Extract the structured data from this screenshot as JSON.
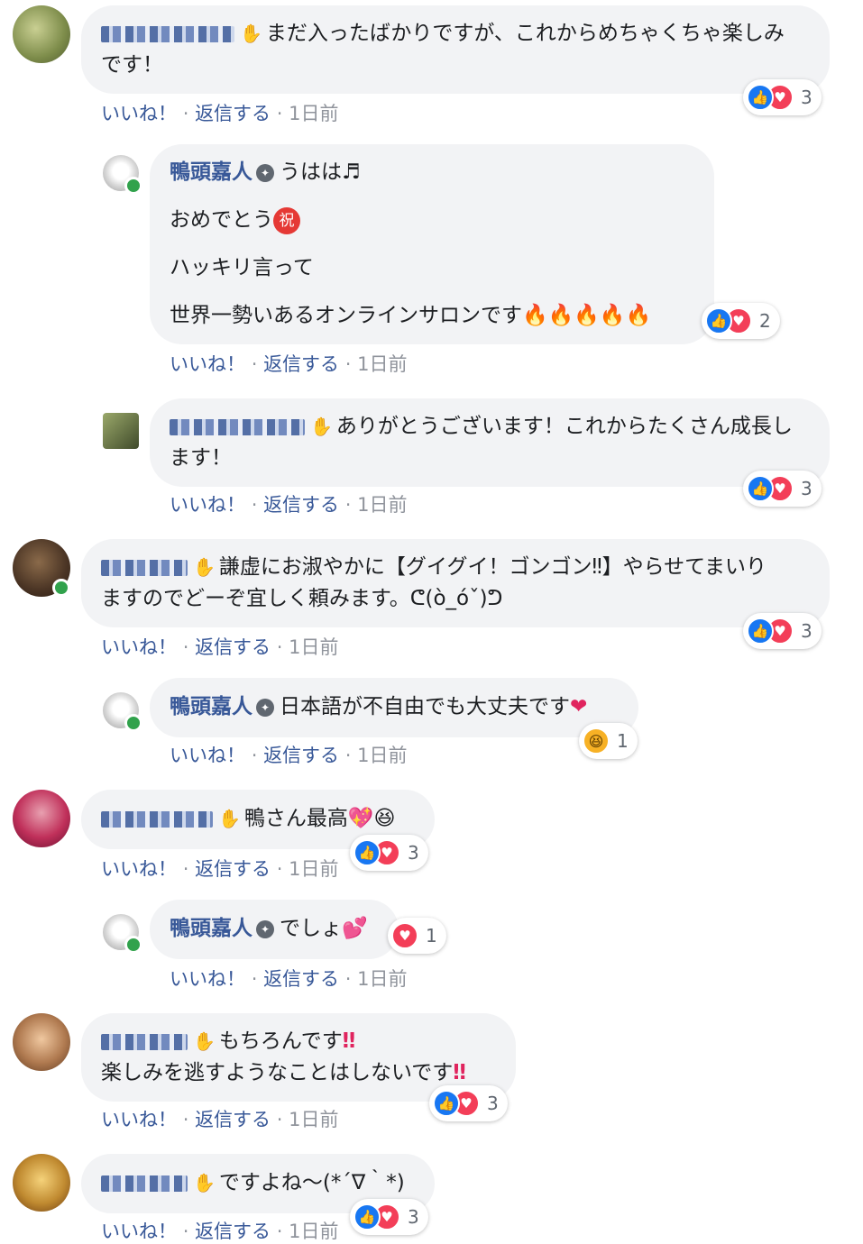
{
  "comments": [
    {
      "author_name": "",
      "text_lines": [
        "まだ入ったばかりですが、これからめちゃくちゃ楽しみ",
        "です！"
      ],
      "reactions": {
        "icons": [
          "like-icon",
          "love-icon"
        ],
        "count": "3"
      }
    },
    {
      "author_name": "鴨頭嘉人",
      "text_lines": [
        "うはは♬",
        "おめでとう",
        "ハッキリ言って",
        "世界一勢いあるオンラインサロンです"
      ],
      "badge": "祝",
      "reactions": {
        "icons": [
          "like-icon",
          "love-icon"
        ],
        "count": "2"
      }
    },
    {
      "author_name": "",
      "text_lines": [
        "ありがとうございます！これからたくさん成長し",
        "ます！"
      ],
      "reactions": {
        "icons": [
          "like-icon",
          "love-icon"
        ],
        "count": "3"
      }
    },
    {
      "author_name": "",
      "text_lines": [
        "謙虚にお淑やかに【グイグイ！ゴンゴン‼】やらせてまいり",
        "ますのでどーぞ宜しく頼みます。ᕦ(ò_óˇ)ᕤ"
      ],
      "reactions": {
        "icons": [
          "like-icon",
          "love-icon"
        ],
        "count": "3"
      }
    },
    {
      "author_name": "鴨頭嘉人",
      "text_lines": [
        "日本語が不自由でも大丈夫です"
      ],
      "reactions": {
        "icons": [
          "haha-icon"
        ],
        "count": "1"
      }
    },
    {
      "author_name": "",
      "text_lines": [
        "鴨さん最高"
      ],
      "reactions": {
        "icons": [
          "like-icon",
          "love-icon"
        ],
        "count": "3"
      }
    },
    {
      "author_name": "鴨頭嘉人",
      "text_lines": [
        "でしょ"
      ],
      "reactions": {
        "icons": [
          "love-icon"
        ],
        "count": "1"
      }
    },
    {
      "author_name": "",
      "text_lines": [
        "もちろんです",
        "楽しみを逃すようなことはしないです"
      ],
      "reactions": {
        "icons": [
          "like-icon",
          "love-icon"
        ],
        "count": "3"
      }
    },
    {
      "author_name": "",
      "text_lines": [
        "ですよね〜(*´∇｀*)"
      ],
      "reactions": {
        "icons": [
          "like-icon",
          "love-icon"
        ],
        "count": "3"
      }
    }
  ],
  "actions": {
    "like": "いいね！",
    "reply": "返信する",
    "separator": "·",
    "time": "1日前"
  },
  "colors": {
    "link": "#385898",
    "bubble": "#f2f3f5",
    "online": "#31a24c",
    "like": "#1877f2",
    "love": "#f33e58"
  }
}
